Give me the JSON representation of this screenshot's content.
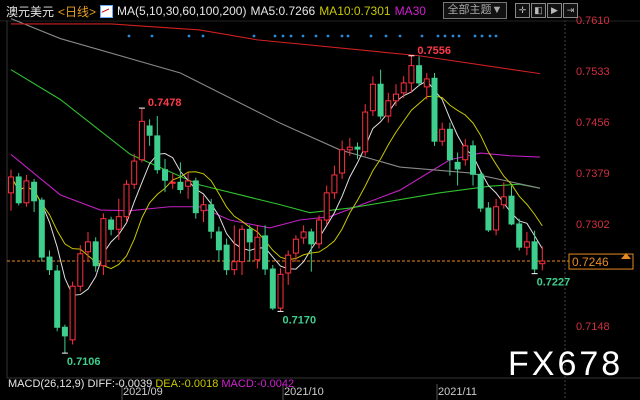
{
  "header": {
    "symbol": "澳元美元",
    "period": "<日线>",
    "ma_params": "MA(5,10,30,60,100,200)",
    "ma5": "MA5:0.7266",
    "ma10": "MA10:0.7301",
    "ma30": "MA30"
  },
  "toolbar": {
    "topic_label": "全部主题▼",
    "icons": [
      "grid-icon",
      "panel-left-icon",
      "play-icon",
      "exit-icon"
    ]
  },
  "watermark": "FX678",
  "macd": {
    "params": "MACD(26,12,9) DIFF:-0.0039",
    "dea": "DEA:-0.0018",
    "macd": "MACD:-0.0042"
  },
  "colors": {
    "up": "#ff3040",
    "down": "#3ecf8e",
    "ma5": "#e0e0e0",
    "ma10": "#c8c800",
    "ma30": "#c020c0",
    "ma60": "#30c030",
    "ma100": "#888888",
    "ma200": "#d02020",
    "current": "#e88a20"
  },
  "chart_data": {
    "type": "candlestick",
    "title": "澳元美元 日线",
    "ylim": [
      0.71,
      0.762
    ],
    "y_ticks": [
      "0.7610",
      "0.7533",
      "0.7456",
      "0.7379",
      "0.7302",
      "0.7148"
    ],
    "current_price": "0.7246",
    "x_labels": [
      "2021/09",
      "2021/10",
      "2021/11"
    ],
    "annotations": [
      {
        "text": "0.7478",
        "index": 17,
        "price": 0.7477,
        "kind": "high"
      },
      {
        "text": "0.7106",
        "index": 7,
        "price": 0.7107,
        "kind": "low"
      },
      {
        "text": "0.7170",
        "index": 35,
        "price": 0.717,
        "kind": "low"
      },
      {
        "text": "0.7556",
        "index": 52,
        "price": 0.7556,
        "kind": "high"
      },
      {
        "text": "0.7227",
        "index": 68,
        "price": 0.7227,
        "kind": "low"
      }
    ],
    "candles": [
      [
        0.7349,
        0.7384,
        0.7322,
        0.7373
      ],
      [
        0.7373,
        0.7379,
        0.733,
        0.7334
      ],
      [
        0.7334,
        0.7376,
        0.7328,
        0.7367
      ],
      [
        0.7365,
        0.737,
        0.732,
        0.7337
      ],
      [
        0.7338,
        0.7342,
        0.7245,
        0.7252
      ],
      [
        0.7252,
        0.7262,
        0.7225,
        0.7233
      ],
      [
        0.7231,
        0.724,
        0.714,
        0.7146
      ],
      [
        0.7146,
        0.715,
        0.7107,
        0.7133
      ],
      [
        0.7127,
        0.7215,
        0.712,
        0.7208
      ],
      [
        0.7208,
        0.727,
        0.72,
        0.7257
      ],
      [
        0.726,
        0.729,
        0.7245,
        0.7275
      ],
      [
        0.7275,
        0.7282,
        0.723,
        0.7239
      ],
      [
        0.7239,
        0.7318,
        0.7225,
        0.731
      ],
      [
        0.7308,
        0.7313,
        0.7285,
        0.7294
      ],
      [
        0.7294,
        0.734,
        0.7278,
        0.7313
      ],
      [
        0.7313,
        0.7368,
        0.7305,
        0.7362
      ],
      [
        0.7362,
        0.7408,
        0.7355,
        0.7397
      ],
      [
        0.7399,
        0.7477,
        0.7395,
        0.7457
      ],
      [
        0.745,
        0.746,
        0.742,
        0.7436
      ],
      [
        0.7435,
        0.7465,
        0.7378,
        0.7384
      ],
      [
        0.7384,
        0.74,
        0.735,
        0.7368
      ],
      [
        0.7364,
        0.7378,
        0.7355,
        0.7365
      ],
      [
        0.7365,
        0.7395,
        0.7348,
        0.7354
      ],
      [
        0.7359,
        0.738,
        0.734,
        0.7367
      ],
      [
        0.7367,
        0.7372,
        0.731,
        0.7319
      ],
      [
        0.7322,
        0.7345,
        0.7305,
        0.7331
      ],
      [
        0.7331,
        0.734,
        0.728,
        0.7291
      ],
      [
        0.729,
        0.7298,
        0.7245,
        0.7263
      ],
      [
        0.727,
        0.728,
        0.7225,
        0.7233
      ],
      [
        0.7233,
        0.73,
        0.7225,
        0.7245
      ],
      [
        0.7245,
        0.73,
        0.7225,
        0.7294
      ],
      [
        0.7294,
        0.73,
        0.7245,
        0.7275
      ],
      [
        0.7248,
        0.73,
        0.7235,
        0.7282
      ],
      [
        0.7284,
        0.73,
        0.7225,
        0.7234
      ],
      [
        0.7234,
        0.724,
        0.7172,
        0.7175
      ],
      [
        0.7175,
        0.7235,
        0.717,
        0.7226
      ],
      [
        0.7228,
        0.7262,
        0.721,
        0.7255
      ],
      [
        0.7258,
        0.7285,
        0.7245,
        0.7279
      ],
      [
        0.7281,
        0.73,
        0.7272,
        0.729
      ],
      [
        0.729,
        0.7295,
        0.723,
        0.7272
      ],
      [
        0.7272,
        0.7315,
        0.7265,
        0.7308
      ],
      [
        0.7308,
        0.736,
        0.73,
        0.7349
      ],
      [
        0.7349,
        0.739,
        0.734,
        0.7376
      ],
      [
        0.7379,
        0.7428,
        0.737,
        0.7414
      ],
      [
        0.7414,
        0.7432,
        0.7405,
        0.7418
      ],
      [
        0.7418,
        0.7425,
        0.74,
        0.7415
      ],
      [
        0.7411,
        0.7483,
        0.7405,
        0.7471
      ],
      [
        0.7473,
        0.7525,
        0.7465,
        0.7513
      ],
      [
        0.7513,
        0.7535,
        0.746,
        0.7465
      ],
      [
        0.7465,
        0.75,
        0.7455,
        0.7488
      ],
      [
        0.7488,
        0.7513,
        0.748,
        0.7498
      ],
      [
        0.75,
        0.7525,
        0.7492,
        0.7515
      ],
      [
        0.7515,
        0.7556,
        0.75,
        0.7541
      ],
      [
        0.7541,
        0.7555,
        0.751,
        0.7515
      ],
      [
        0.7509,
        0.753,
        0.749,
        0.7521
      ],
      [
        0.7522,
        0.753,
        0.742,
        0.7427
      ],
      [
        0.7427,
        0.7455,
        0.742,
        0.7445
      ],
      [
        0.7445,
        0.7455,
        0.7375,
        0.7399
      ],
      [
        0.7395,
        0.741,
        0.736,
        0.7385
      ],
      [
        0.7399,
        0.743,
        0.739,
        0.742
      ],
      [
        0.742,
        0.7428,
        0.736,
        0.7377
      ],
      [
        0.7377,
        0.738,
        0.732,
        0.7326
      ],
      [
        0.7326,
        0.7335,
        0.729,
        0.7293
      ],
      [
        0.7293,
        0.734,
        0.7285,
        0.7328
      ],
      [
        0.7331,
        0.7365,
        0.7325,
        0.7343
      ],
      [
        0.7344,
        0.736,
        0.73,
        0.7302
      ],
      [
        0.7302,
        0.731,
        0.7262,
        0.7267
      ],
      [
        0.7267,
        0.729,
        0.7255,
        0.7275
      ],
      [
        0.7275,
        0.7292,
        0.7227,
        0.7234
      ],
      [
        0.7242,
        0.7268,
        0.7232,
        0.7246
      ]
    ],
    "ma_lines": [
      {
        "name": "MA30",
        "color_key": "ma30",
        "points": [
          [
            0,
            0.7407
          ],
          [
            6.4,
            0.7346
          ],
          [
            11.6,
            0.7323
          ],
          [
            15.5,
            0.7322
          ],
          [
            20.6,
            0.7328
          ],
          [
            24.5,
            0.7328
          ],
          [
            28.4,
            0.7308
          ],
          [
            33.6,
            0.7296
          ],
          [
            37.5,
            0.7308
          ],
          [
            41.4,
            0.7313
          ],
          [
            50.5,
            0.7353
          ],
          [
            57,
            0.7399
          ],
          [
            61,
            0.7409
          ],
          [
            64.8,
            0.7405
          ],
          [
            68.7,
            0.7403
          ]
        ]
      },
      {
        "name": "MA60",
        "color_key": "ma60",
        "points": [
          [
            0,
            0.7535
          ],
          [
            6.4,
            0.749
          ],
          [
            15.5,
            0.7407
          ],
          [
            24.5,
            0.7361
          ],
          [
            35,
            0.7331
          ],
          [
            38.8,
            0.7319
          ],
          [
            44,
            0.7326
          ],
          [
            55.7,
            0.7349
          ],
          [
            62.2,
            0.7359
          ],
          [
            66,
            0.7362
          ],
          [
            68.7,
            0.7356
          ]
        ]
      },
      {
        "name": "MA100",
        "color_key": "ma100",
        "points": [
          [
            0,
            0.7612
          ],
          [
            6.4,
            0.7582
          ],
          [
            22,
            0.753
          ],
          [
            35,
            0.7454
          ],
          [
            42.7,
            0.7414
          ],
          [
            50.5,
            0.7388
          ],
          [
            59.6,
            0.7379
          ],
          [
            68.7,
            0.7356
          ]
        ]
      },
      {
        "name": "MA200",
        "color_key": "ma200",
        "points": [
          [
            0,
            0.7604
          ],
          [
            13,
            0.7604
          ],
          [
            24.5,
            0.7595
          ],
          [
            32,
            0.758
          ],
          [
            53,
            0.7556
          ],
          [
            68.7,
            0.7529
          ]
        ]
      }
    ]
  }
}
